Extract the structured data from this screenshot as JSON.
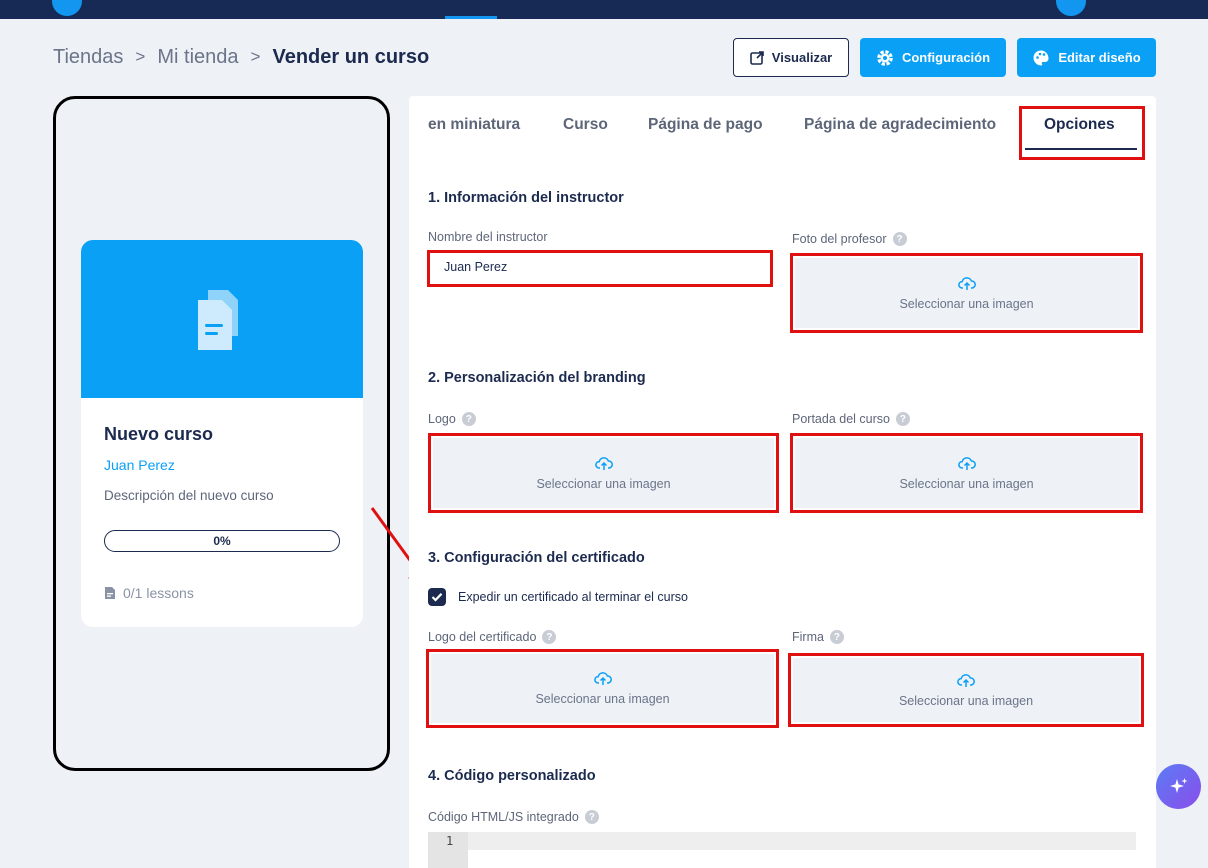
{
  "breadcrumb": {
    "items": [
      "Tiendas",
      "Mi tienda",
      "Vender un curso"
    ],
    "separator": ">"
  },
  "toolbar": {
    "preview_label": "Visualizar",
    "config_label": "Configuración",
    "edit_design_label": "Editar diseño"
  },
  "preview_card": {
    "title": "Nuevo curso",
    "author": "Juan Perez",
    "description": "Descripción del nuevo curso",
    "progress_text": "0%",
    "progress": 0,
    "lessons": "0/1 lessons"
  },
  "tabs": [
    {
      "label": "en miniatura",
      "active": false
    },
    {
      "label": "Curso",
      "active": false
    },
    {
      "label": "Página de pago",
      "active": false
    },
    {
      "label": "Página de agradecimiento",
      "active": false
    },
    {
      "label": "Opciones",
      "active": true
    }
  ],
  "sections": {
    "instructor": {
      "title": "1. Información del instructor",
      "name_label": "Nombre del instructor",
      "name_value": "Juan Perez",
      "photo_label": "Foto del profesor",
      "photo_upload": "Seleccionar una imagen"
    },
    "branding": {
      "title": "2. Personalización del branding",
      "logo_label": "Logo",
      "logo_upload": "Seleccionar una imagen",
      "cover_label": "Portada del curso",
      "cover_upload": "Seleccionar una imagen"
    },
    "certificate": {
      "title": "3. Configuración del certificado",
      "checkbox_label": "Expedir un certificado al terminar el curso",
      "checkbox_checked": true,
      "logo_label": "Logo del certificado",
      "logo_upload": "Seleccionar una imagen",
      "signature_label": "Firma",
      "signature_upload": "Seleccionar una imagen"
    },
    "custom_code": {
      "title": "4. Código personalizado",
      "code_label": "Código HTML/JS integrado",
      "line_number": "1"
    }
  },
  "help_glyph": "?",
  "colors": {
    "navy": "#1b2a4e",
    "accent": "#0aa0f5",
    "highlight": "#e01010"
  }
}
